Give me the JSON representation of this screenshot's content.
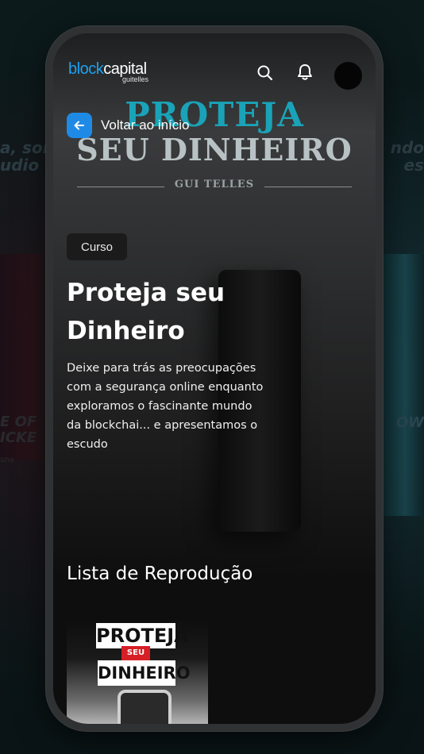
{
  "backdrop": {
    "left_text": [
      "a, sol",
      "udio Co"
    ],
    "right_text": [
      "ndo",
      "es"
    ],
    "left_text2": [
      "E OF",
      "ICKE",
      "sna"
    ],
    "right_text2": "OW"
  },
  "header": {
    "logo_block": "block",
    "logo_capital": "capital",
    "logo_sub": "guitelles",
    "search_icon": "search-icon",
    "bell_icon": "bell-icon"
  },
  "hero": {
    "title_line1": "PROTEJA",
    "title_line2": "SEU DINHEIRO",
    "author": "GUI TELLES"
  },
  "back": {
    "label": "Voltar ao início",
    "icon": "arrow-left-icon"
  },
  "course": {
    "badge": "Curso",
    "title": "Proteja seu Dinheiro",
    "description": "Deixe para trás as preocupações com a segurança online enquanto exploramos o fascinante mundo da blockchai... e apresentamos o escudo"
  },
  "playlist": {
    "heading": "Lista de Reprodução",
    "items": [
      {
        "line1": "PROTEJA",
        "line2": "SEU",
        "line3": "DINHEIRO"
      }
    ]
  },
  "colors": {
    "accent_blue": "#1f8ae6",
    "hero_title_teal": "#1aa3b8",
    "badge_red": "#d61f26"
  }
}
